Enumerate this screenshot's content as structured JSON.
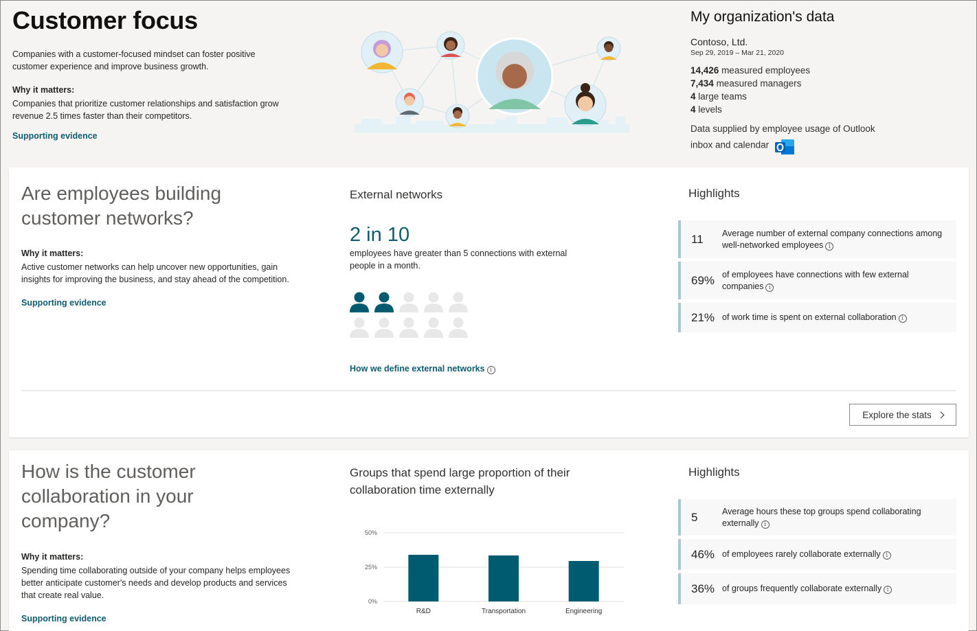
{
  "hero": {
    "title": "Customer focus",
    "description": "Companies with a customer-focused mindset can foster positive customer experience and improve business growth.",
    "why_title": "Why it matters:",
    "why_text": "Companies that prioritize customer relationships and satisfaction grow revenue 2.5 times faster than their competitors.",
    "link": "Supporting evidence"
  },
  "org": {
    "title": "My organization's data",
    "company": "Contoso, Ltd.",
    "dates": "Sep 29, 2019 – Mar 21, 2020",
    "stats": [
      {
        "value": "14,426",
        "label": "measured employees"
      },
      {
        "value": "7,434",
        "label": "measured managers"
      },
      {
        "value": "4",
        "label": "large teams"
      },
      {
        "value": "4",
        "label": "levels"
      }
    ],
    "source": "Data supplied by employee usage of Outlook inbox and calendar",
    "source_icon": "outlook-icon"
  },
  "section1": {
    "question": "Are employees building customer networks?",
    "why_title": "Why it matters:",
    "why_text": "Active customer networks can help uncover new opportunities, gain insights for improving the business, and stay ahead of the competition.",
    "link": "Supporting evidence",
    "mid_title": "External networks",
    "big_stat": "2 in 10",
    "big_stat_desc": "employees have greater than 5 connections with external people in a month.",
    "people_highlighted": 2,
    "people_total": 10,
    "def_link": "How we define external networks",
    "highlights_title": "Highlights",
    "highlights": [
      {
        "value": "11",
        "text": "Average number of external company connections among well-networked employees"
      },
      {
        "value": "69%",
        "text": "of employees have connections with few external companies"
      },
      {
        "value": "21%",
        "text": "of work time is spent on external collaboration"
      }
    ],
    "explore": "Explore the stats"
  },
  "section2": {
    "question": "How is the customer collaboration in your company?",
    "why_title": "Why it matters:",
    "why_text": "Spending time collaborating outside of your company helps employees better anticipate customer's needs and develop products and services that create real value.",
    "link": "Supporting evidence",
    "mid_title": "Groups that spend large proportion of their collaboration time externally",
    "highlights_title": "Highlights",
    "highlights": [
      {
        "value": "5",
        "text": "Average hours these top groups spend collaborating externally"
      },
      {
        "value": "46%",
        "text": "of employees rarely collaborate externally"
      },
      {
        "value": "36%",
        "text": "of groups frequently collaborate externally"
      }
    ]
  },
  "chart_data": {
    "type": "bar",
    "categories": [
      "R&D",
      "Transportation",
      "Engineering"
    ],
    "values": [
      34,
      33.5,
      29.5
    ],
    "ytick_labels": [
      "50%",
      "25%",
      "0%"
    ],
    "ylim": [
      0,
      50
    ],
    "grid": true,
    "bar_color": "#005b70"
  },
  "colors": {
    "accent": "#0f5c6e",
    "person_active": "#005b70",
    "person_inactive": "#e8e8e8",
    "highlight_border": "#a8c9d3"
  }
}
